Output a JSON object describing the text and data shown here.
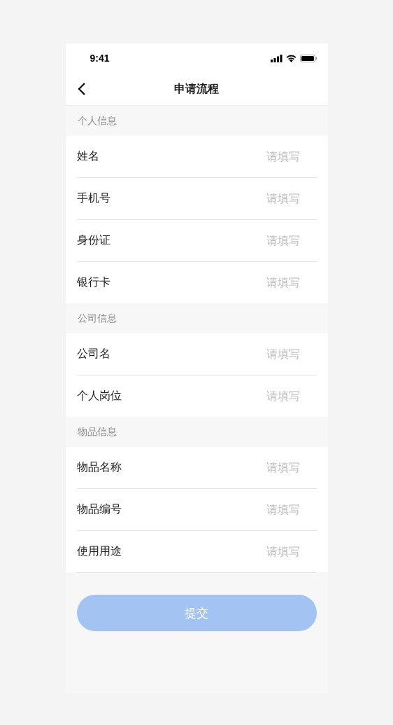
{
  "status_bar": {
    "time": "9:41"
  },
  "nav": {
    "title": "申请流程"
  },
  "sections": [
    {
      "title": "个人信息",
      "fields": [
        {
          "label": "姓名",
          "placeholder": "请填写"
        },
        {
          "label": "手机号",
          "placeholder": "请填写"
        },
        {
          "label": "身份证",
          "placeholder": "请填写"
        },
        {
          "label": "银行卡",
          "placeholder": "请填写"
        }
      ]
    },
    {
      "title": "公司信息",
      "fields": [
        {
          "label": "公司名",
          "placeholder": "请填写"
        },
        {
          "label": "个人岗位",
          "placeholder": "请填写"
        }
      ]
    },
    {
      "title": "物品信息",
      "fields": [
        {
          "label": "物品名称",
          "placeholder": "请填写"
        },
        {
          "label": "物品编号",
          "placeholder": "请填写"
        },
        {
          "label": "使用用途",
          "placeholder": "请填写"
        }
      ]
    }
  ],
  "submit": {
    "label": "提交",
    "disabled": true
  }
}
